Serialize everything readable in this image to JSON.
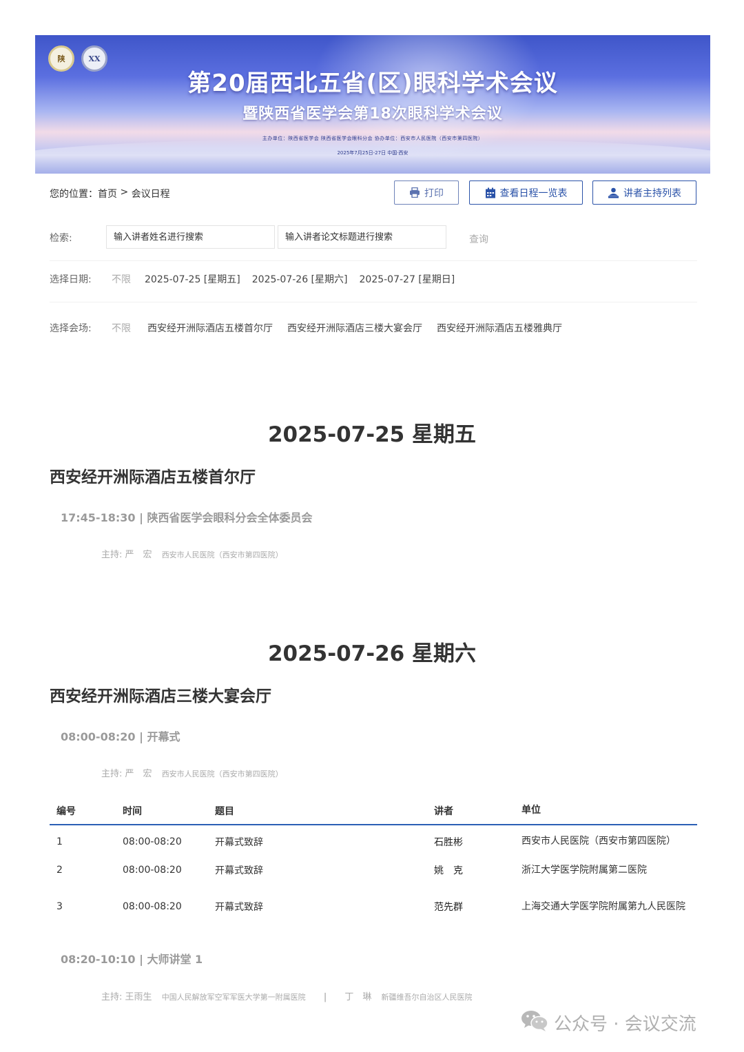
{
  "banner": {
    "logo_left": "陕",
    "logo_right": "XX",
    "title_line1": "第20届西北五省(区)眼科学术会议",
    "title_line2": "暨陕西省医学会第18次眼科学术会议",
    "organizers": "主办单位：陕西省医学会  陕西省医学会眼科分会    协办单位：西安市人民医院（西安市第四医院）",
    "date_place": "2025年7月25日-27日   中国·西安"
  },
  "breadcrumb": {
    "prefix": "您的位置：",
    "home": "首页",
    "separator": " > ",
    "current": "会议日程"
  },
  "buttons": {
    "print": "打印",
    "schedule_overview": "查看日程一览表",
    "speaker_list": "讲者主持列表"
  },
  "search": {
    "label": "检索:",
    "name_placeholder": "输入讲者姓名进行搜索",
    "title_placeholder": "输入讲者论文标题进行搜索",
    "query": "查询"
  },
  "date_filter": {
    "label": "选择日期:",
    "options": [
      "不限",
      "2025-07-25 [星期五]",
      "2025-07-26 [星期六]",
      "2025-07-27 [星期日]"
    ]
  },
  "venue_filter": {
    "label": "选择会场:",
    "options": [
      "不限",
      "西安经开洲际酒店五楼首尔厅",
      "西安经开洲际酒店三楼大宴会厅",
      "西安经开洲际酒店五楼雅典厅"
    ]
  },
  "days": [
    {
      "heading": "2025-07-25 星期五",
      "hall": "西安经开洲际酒店五楼首尔厅",
      "sessions": [
        {
          "title": "17:45-18:30 | 陕西省医学会眼科分会全体委员会",
          "host_label": "主持:",
          "host_name": "严　宏",
          "host_org": "西安市人民医院（西安市第四医院）"
        }
      ]
    },
    {
      "heading": "2025-07-26 星期六",
      "hall": "西安经开洲际酒店三楼大宴会厅",
      "sessions": [
        {
          "title": "08:00-08:20 | 开幕式",
          "host_label": "主持:",
          "host_name": "严　宏",
          "host_org": "西安市人民医院（西安市第四医院）"
        },
        {
          "title": "08:20-10:10 | 大师讲堂 1",
          "host_label": "主持:",
          "host_name": "王雨生",
          "host_org": "中国人民解放军空军军医大学第一附属医院",
          "host_sep": "|",
          "host2_name": "丁　琳",
          "host2_org": "新疆维吾尔自治区人民医院"
        }
      ]
    }
  ],
  "table": {
    "headers": [
      "编号",
      "时间",
      "题目",
      "讲者",
      "单位"
    ],
    "rows": [
      [
        "1",
        "08:00-08:20",
        "开幕式致辞",
        "石胜彬",
        "西安市人民医院（西安市第四医院）"
      ],
      [
        "2",
        "08:00-08:20",
        "开幕式致辞",
        "姚　克",
        "浙江大学医学院附属第二医院"
      ],
      [
        "3",
        "08:00-08:20",
        "开幕式致辞",
        "范先群",
        "上海交通大学医学院附属第九人民医院"
      ]
    ]
  },
  "watermark": {
    "text": "公众号 · 会议交流",
    "icon": "wechat-icon"
  }
}
